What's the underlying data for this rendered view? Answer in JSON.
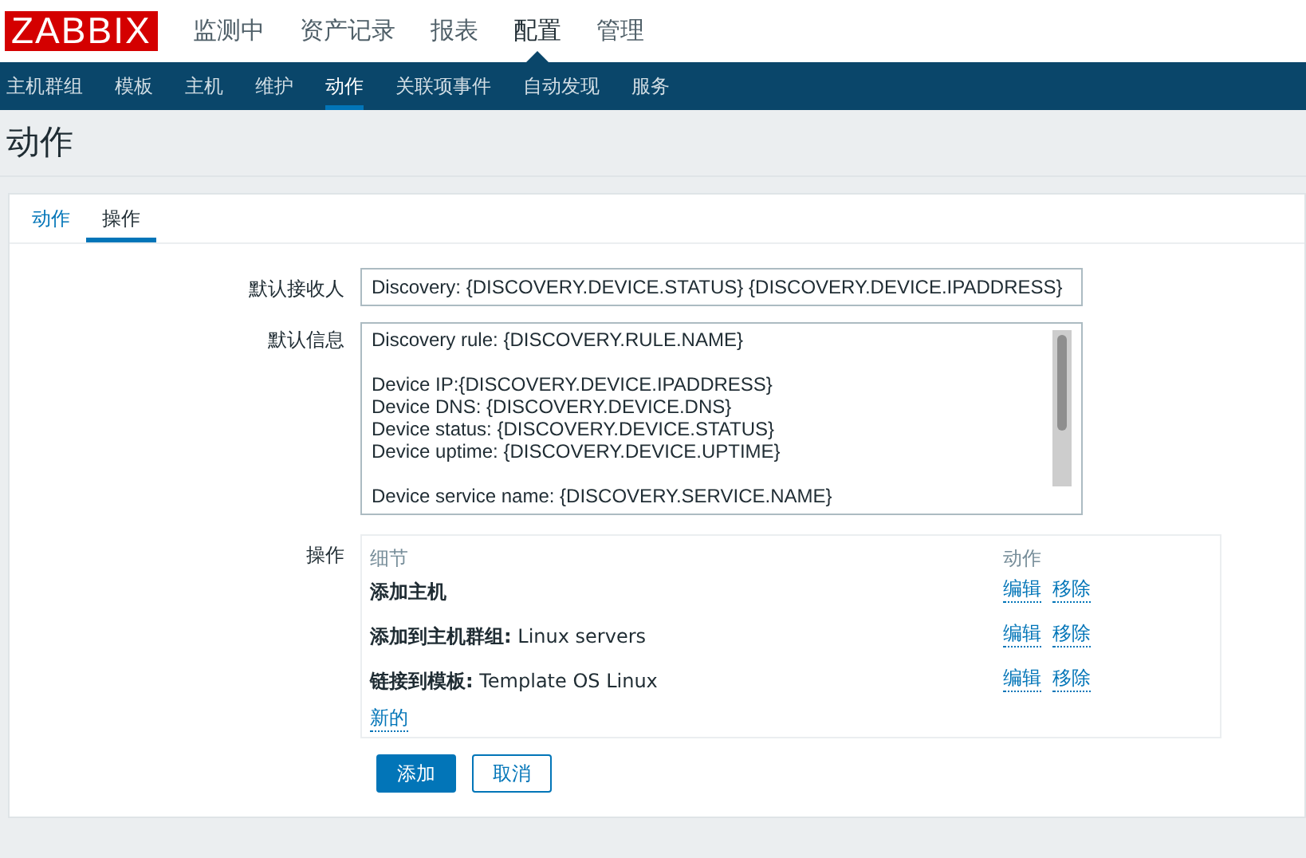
{
  "logo": "ZABBIX",
  "main_menu": [
    {
      "label": "监测中",
      "selected": false
    },
    {
      "label": "资产记录",
      "selected": false
    },
    {
      "label": "报表",
      "selected": false
    },
    {
      "label": "配置",
      "selected": true
    },
    {
      "label": "管理",
      "selected": false
    }
  ],
  "sub_menu": [
    {
      "label": "主机群组",
      "selected": false
    },
    {
      "label": "模板",
      "selected": false
    },
    {
      "label": "主机",
      "selected": false
    },
    {
      "label": "维护",
      "selected": false
    },
    {
      "label": "动作",
      "selected": true
    },
    {
      "label": "关联项事件",
      "selected": false
    },
    {
      "label": "自动发现",
      "selected": false
    },
    {
      "label": "服务",
      "selected": false
    }
  ],
  "page_title": "动作",
  "tabs": [
    {
      "label": "动作",
      "selected": false
    },
    {
      "label": "操作",
      "selected": true
    }
  ],
  "form": {
    "default_subject": {
      "label": "默认接收人",
      "value": "Discovery: {DISCOVERY.DEVICE.STATUS} {DISCOVERY.DEVICE.IPADDRESS}"
    },
    "default_message": {
      "label": "默认信息",
      "value": "Discovery rule: {DISCOVERY.RULE.NAME}\n\nDevice IP:{DISCOVERY.DEVICE.IPADDRESS}\nDevice DNS: {DISCOVERY.DEVICE.DNS}\nDevice status: {DISCOVERY.DEVICE.STATUS}\nDevice uptime: {DISCOVERY.DEVICE.UPTIME}\n\nDevice service name: {DISCOVERY.SERVICE.NAME}"
    },
    "operations": {
      "label": "操作",
      "columns": [
        "细节",
        "动作"
      ],
      "rows": [
        {
          "detail": "**添加主机**",
          "actions": [
            "编辑",
            "移除"
          ]
        },
        {
          "detail": "**添加到主机群组:** Linux servers",
          "actions": [
            "编辑",
            "移除"
          ]
        },
        {
          "detail": "**链接到模板:** Template OS Linux",
          "actions": [
            "编辑",
            "移除"
          ]
        }
      ],
      "new_link": "新的"
    }
  },
  "buttons": [
    {
      "label": "添加",
      "kind": "primary"
    },
    {
      "label": "取消",
      "kind": "secondary"
    }
  ]
}
